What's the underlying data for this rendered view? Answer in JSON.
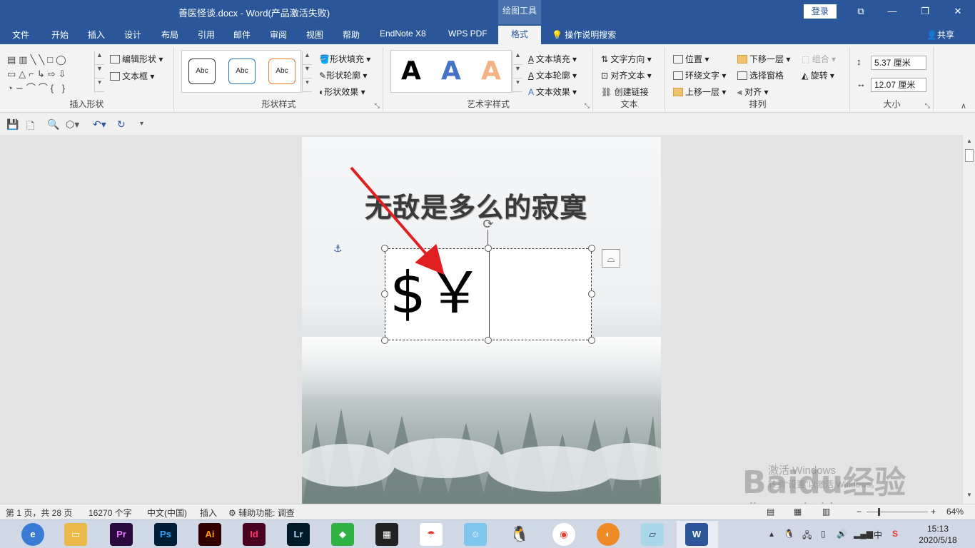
{
  "window": {
    "title": "善医怪谈.docx  -  Word(产品激活失败)",
    "context_tools": "绘图工具",
    "login": "登录"
  },
  "tabs": [
    "文件",
    "开始",
    "插入",
    "设计",
    "布局",
    "引用",
    "邮件",
    "审阅",
    "视图",
    "帮助",
    "EndNote X8",
    "WPS PDF"
  ],
  "active_tab": "格式",
  "tell_me": "操作说明搜索",
  "share": "共享",
  "ribbon": {
    "insert_shapes": {
      "label": "插入形状",
      "edit_shape": "编辑形状",
      "text_box": "文本框"
    },
    "shape_styles": {
      "label": "形状样式",
      "sample": "Abc",
      "fill": "形状填充",
      "outline": "形状轮廓",
      "effects": "形状效果",
      "colors": [
        "#111111",
        "#2e75b6",
        "#ed7d31"
      ]
    },
    "wordart_styles": {
      "label": "艺术字样式",
      "sample": "A",
      "text_fill": "文本填充",
      "text_outline": "文本轮廓",
      "text_effects": "文本效果",
      "colors": [
        "#000000",
        "#4472c4",
        "#f4b183"
      ]
    },
    "text": {
      "label": "文本",
      "direction": "文字方向",
      "align": "对齐文本",
      "link": "创建链接"
    },
    "arrange": {
      "label": "排列",
      "position": "位置",
      "wrap": "环绕文字",
      "forward": "上移一层",
      "backward": "下移一层",
      "selection_pane": "选择窗格",
      "align": "对齐",
      "group": "组合",
      "rotate": "旋转"
    },
    "size": {
      "label": "大小",
      "height": "5.37 厘米",
      "width": "12.07 厘米"
    }
  },
  "document": {
    "heading": "无敌是多么的寂寞",
    "textbox_content": "$￥"
  },
  "watermark": {
    "activate_1": "激活 Windows",
    "activate_2": "转到“设置”以激活 Windows。",
    "brand": "Baidu经验",
    "url": "jingyan.baidu.com"
  },
  "status": {
    "page": "第 1 页，共 28 页",
    "words": "16270 个字",
    "language": "中文(中国)",
    "mode": "插入",
    "accessibility": "辅助功能: 调查",
    "zoom": "64%"
  },
  "taskbar": {
    "apps": [
      "Pr",
      "Ps",
      "Ai",
      "Id",
      "Lr"
    ],
    "ime": "中",
    "time": "15:13",
    "date": "2020/5/18"
  }
}
